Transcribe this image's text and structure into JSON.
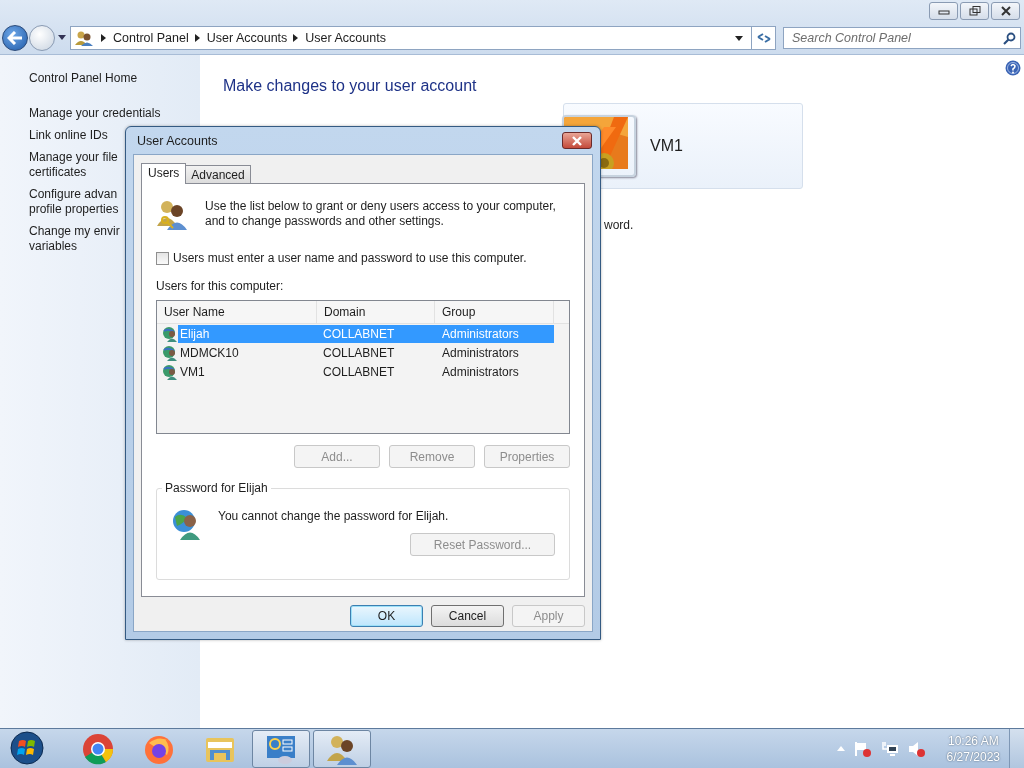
{
  "address_bar": {
    "breadcrumbs": [
      "Control Panel",
      "User Accounts",
      "User Accounts"
    ]
  },
  "search": {
    "placeholder": "Search Control Panel"
  },
  "sidebar": {
    "items": [
      {
        "lines": [
          "Control Panel Home"
        ]
      },
      {
        "lines": [
          "Manage your credentials"
        ]
      },
      {
        "lines": [
          "Link online IDs"
        ]
      },
      {
        "lines": [
          "Manage your file",
          "certificates"
        ]
      },
      {
        "lines": [
          "Configure advan",
          "profile properties"
        ]
      },
      {
        "lines": [
          "Change my envir",
          "variables"
        ]
      }
    ]
  },
  "content": {
    "heading": "Make changes to your user account",
    "account_name": "VM1",
    "fragment": "word."
  },
  "dialog": {
    "title": "User Accounts",
    "tabs": [
      {
        "label": "Users",
        "selected": true
      },
      {
        "label": "Advanced",
        "selected": false
      }
    ],
    "intro": "Use the list below to grant or deny users access to your computer, and to change passwords and other settings.",
    "require_password": {
      "label": "Users must enter a user name and password to use this computer.",
      "checked": false
    },
    "list_label": "Users for this computer:",
    "columns": [
      "User Name",
      "Domain",
      "Group"
    ],
    "rows": [
      {
        "user": "Elijah",
        "domain": "COLLABNET",
        "group": "Administrators",
        "selected": true
      },
      {
        "user": "MDMCK10",
        "domain": "COLLABNET",
        "group": "Administrators",
        "selected": false
      },
      {
        "user": "VM1",
        "domain": "COLLABNET",
        "group": "Administrators",
        "selected": false
      }
    ],
    "list_buttons": [
      {
        "label": "Add...",
        "disabled": true
      },
      {
        "label": "Remove",
        "disabled": true
      },
      {
        "label": "Properties",
        "disabled": true
      }
    ],
    "password_group": {
      "title": "Password for Elijah",
      "message": "You cannot change the password for Elijah.",
      "button": {
        "label": "Reset Password...",
        "disabled": true
      }
    },
    "buttons": [
      {
        "label": "OK",
        "default": true,
        "disabled": false
      },
      {
        "label": "Cancel",
        "default": false,
        "disabled": false
      },
      {
        "label": "Apply",
        "default": false,
        "disabled": true
      }
    ]
  },
  "taskbar": {
    "apps": [
      {
        "kind": "chrome",
        "active": false
      },
      {
        "kind": "firefox",
        "active": false
      },
      {
        "kind": "folder",
        "active": false
      },
      {
        "kind": "control-panel",
        "active": true
      },
      {
        "kind": "users",
        "active": true
      }
    ]
  },
  "clock": {
    "time": "10:26 AM",
    "date": "6/27/2023"
  }
}
